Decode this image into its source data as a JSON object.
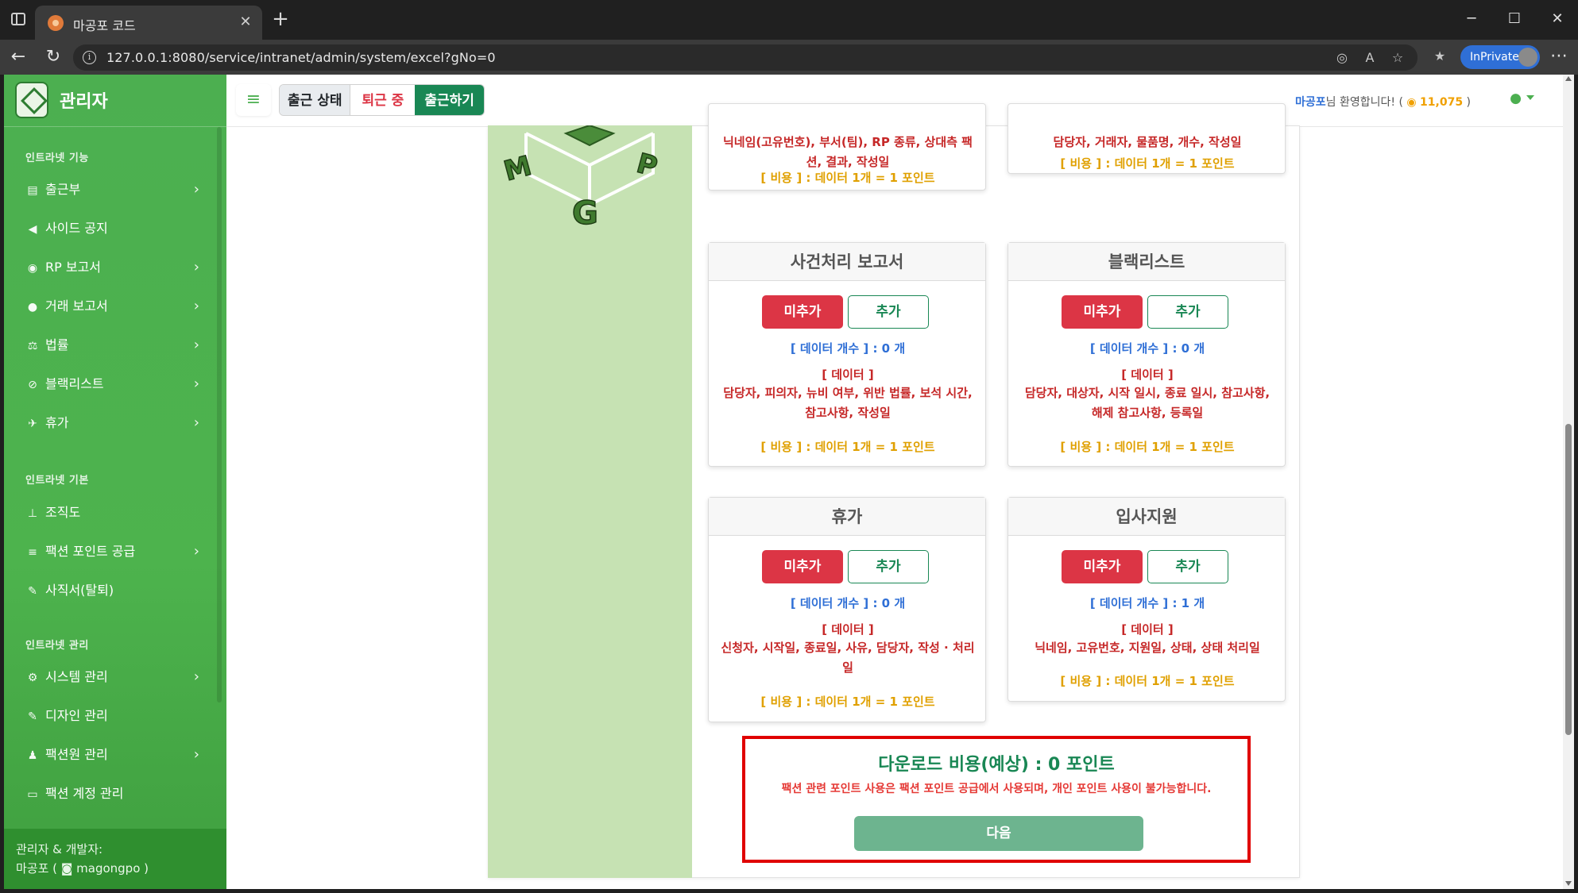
{
  "browser": {
    "tab_title": "마공포 코드",
    "url": "127.0.0.1:8080/service/intranet/admin/system/excel?gNo=0",
    "inprivate_label": "InPrivate"
  },
  "sidebar": {
    "brand": "관리자",
    "sections": [
      {
        "title": "인트라넷 기능"
      },
      {
        "title": "인트라넷 기본"
      },
      {
        "title": "인트라넷 관리"
      }
    ],
    "items": [
      {
        "label": "출근부",
        "icon": "book-icon",
        "has_submenu": true
      },
      {
        "label": "사이드 공지",
        "icon": "megaphone-icon",
        "has_submenu": false
      },
      {
        "label": "RP 보고서",
        "icon": "gamepad-icon",
        "has_submenu": true
      },
      {
        "label": "거래 보고서",
        "icon": "money-bag-icon",
        "has_submenu": true
      },
      {
        "label": "법률",
        "icon": "scale-icon",
        "has_submenu": true
      },
      {
        "label": "블랙리스트",
        "icon": "ban-icon",
        "has_submenu": true
      },
      {
        "label": "휴가",
        "icon": "plane-icon",
        "has_submenu": true
      },
      {
        "label": "조직도",
        "icon": "sitemap-icon",
        "has_submenu": false
      },
      {
        "label": "팩션 포인트 공급",
        "icon": "coins-icon",
        "has_submenu": true
      },
      {
        "label": "사직서(탈퇴)",
        "icon": "feather-icon",
        "has_submenu": false
      },
      {
        "label": "시스템 관리",
        "icon": "gear-icon",
        "has_submenu": true
      },
      {
        "label": "디자인 관리",
        "icon": "pen-icon",
        "has_submenu": false
      },
      {
        "label": "팩션원 관리",
        "icon": "user-gear-icon",
        "has_submenu": true
      },
      {
        "label": "팩션 계정 관리",
        "icon": "id-card-icon",
        "has_submenu": false
      }
    ],
    "footer_line1": "관리자 & 개발자:",
    "footer_name": "마공포 (",
    "footer_discord": "magongpo )"
  },
  "header": {
    "status_label": "출근 상태",
    "status_value": "퇴근 중",
    "checkin_button": "출근하기",
    "welcome_name": "마공포",
    "welcome_text": "님 환영합니다! (",
    "points": "11,075",
    "points_close": ")"
  },
  "cards": [
    {
      "data_fields": "닉네임(고유번호), 부서(팀), RP 종류, 상대측 팩션, 결과, 작성일",
      "cost": "[ 비용 ] : 데이터 1개 = 1 포인트"
    },
    {
      "data_fields": "담당자, 거래자, 물품명, 개수, 작성일",
      "cost": "[ 비용 ] : 데이터 1개 = 1 포인트"
    },
    {
      "title": "사건처리 보고서",
      "btn_exclude": "미추가",
      "btn_include": "추가",
      "count": "[ 데이터 개수 ] : 0 개",
      "data_header": "[ 데이터 ]",
      "data_fields": "담당자, 피의자, 뉴비 여부, 위반 법률, 보석 시간, 참고사항, 작성일",
      "cost": "[ 비용 ] : 데이터 1개 = 1 포인트"
    },
    {
      "title": "블랙리스트",
      "btn_exclude": "미추가",
      "btn_include": "추가",
      "count": "[ 데이터 개수 ] : 0 개",
      "data_header": "[ 데이터 ]",
      "data_fields": "담당자, 대상자, 시작 일시, 종료 일시, 참고사항, 해제 참고사항, 등록일",
      "cost": "[ 비용 ] : 데이터 1개 = 1 포인트"
    },
    {
      "title": "휴가",
      "btn_exclude": "미추가",
      "btn_include": "추가",
      "count": "[ 데이터 개수 ] : 0 개",
      "data_header": "[ 데이터 ]",
      "data_fields": "신청자, 시작일, 종료일, 사유, 담당자, 작성 · 처리일",
      "cost": "[ 비용 ] : 데이터 1개 = 1 포인트"
    },
    {
      "title": "입사지원",
      "btn_exclude": "미추가",
      "btn_include": "추가",
      "count": "[ 데이터 개수 ] : 1 개",
      "data_header": "[ 데이터 ]",
      "data_fields": "닉네임, 고유번호, 지원일, 상태, 상태 처리일",
      "cost": "[ 비용 ] : 데이터 1개 = 1 포인트"
    }
  ],
  "download": {
    "title": "다운로드 비용(예상) : 0 포인트",
    "note": "팩션 관련 포인트 사용은 팩션 포인트 공급에서 사용되며, 개인 포인트 사용이 불가능합니다.",
    "next_button": "다음"
  },
  "colors": {
    "sidebar": "#4caf50",
    "danger": "#dc3545",
    "success": "#198754",
    "info": "#2f6fd6",
    "warning": "#e0a000"
  }
}
